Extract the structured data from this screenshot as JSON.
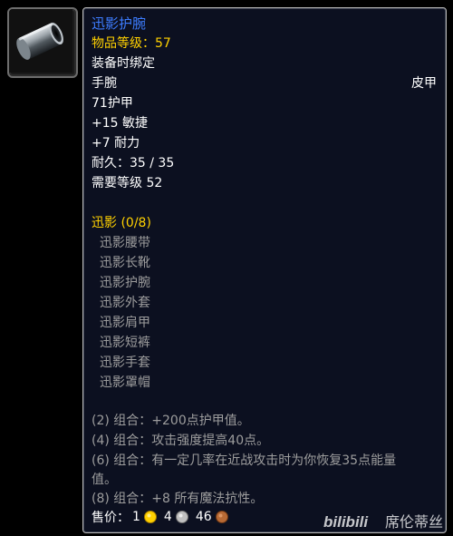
{
  "item": {
    "icon": "bracer-icon",
    "name": "迅影护腕",
    "item_level": "物品等级：57",
    "binding": "装备时绑定",
    "slot": "手腕",
    "armor_type": "皮甲",
    "armor": "71护甲",
    "agility": "+15 敏捷",
    "stamina": "+7 耐力",
    "durability": "耐久：35 / 35",
    "required_level": "需要等级 52"
  },
  "set": {
    "title": "迅影 (0/8)",
    "pieces": [
      "迅影腰带",
      "迅影长靴",
      "迅影护腕",
      "迅影外套",
      "迅影肩甲",
      "迅影短裤",
      "迅影手套",
      "迅影罩帽"
    ],
    "bonuses": [
      "(2) 组合：+200点护甲值。",
      "(4) 组合：攻击强度提高40点。",
      "(6) 组合：有一定几率在近战攻击时为你恢复35点能量",
      "值。",
      "(8) 组合：+8 所有魔法抗性。"
    ]
  },
  "sell_price": {
    "label": "售价：",
    "gold": "1",
    "silver": "4",
    "copper": "46"
  },
  "watermark": {
    "brand": "bilibili",
    "author": "席伦蒂丝"
  },
  "colors": {
    "name": "#3d7dff",
    "item_level": "#ffd100",
    "set_title": "#ffd100",
    "inactive": "#9d9d9d",
    "gold_coin": "#ffd100",
    "silver_coin": "#c0c0c0",
    "copper_coin": "#b86a35"
  }
}
